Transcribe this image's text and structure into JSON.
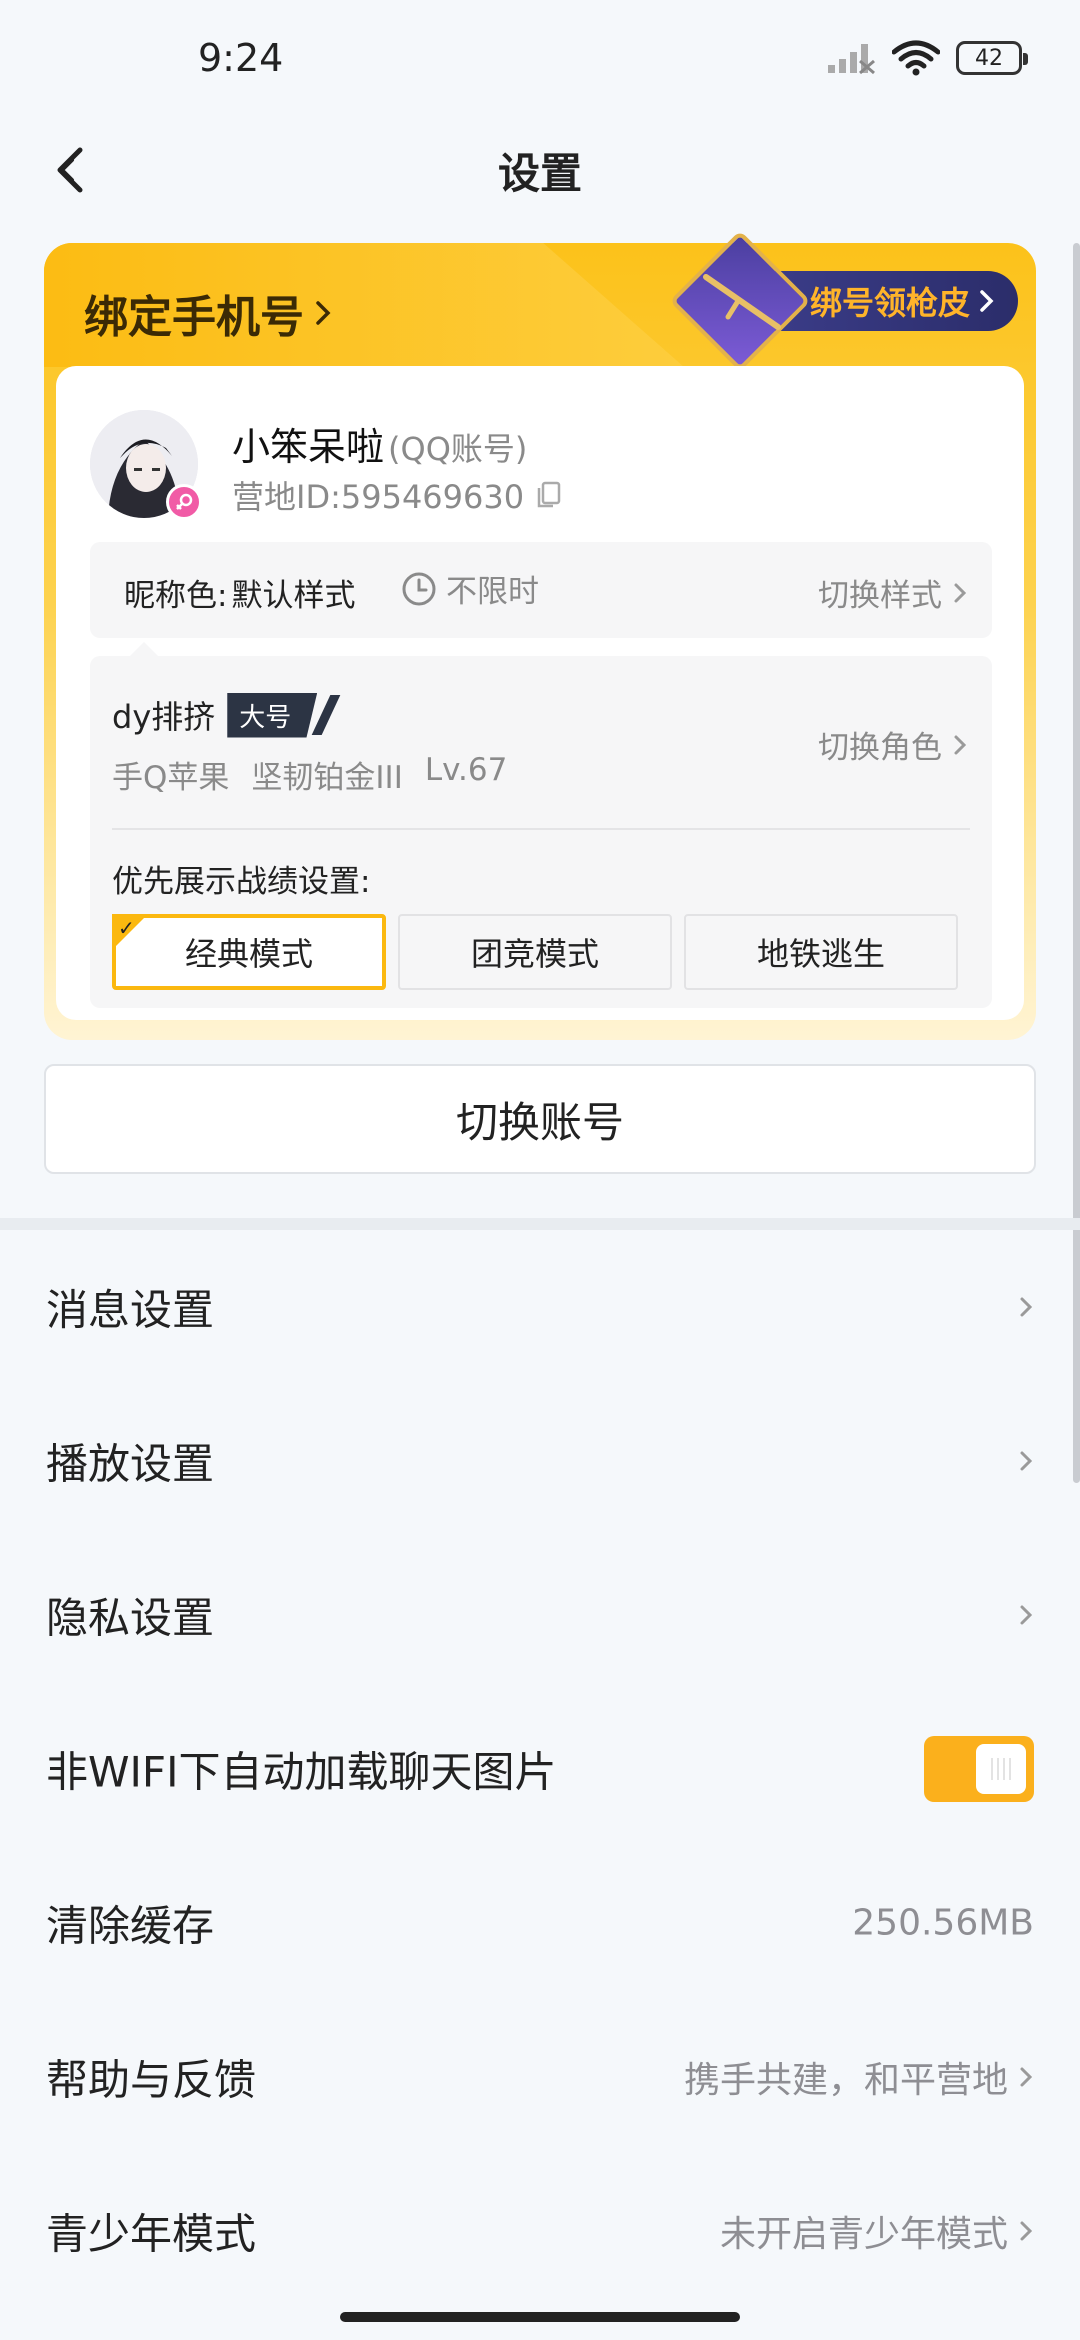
{
  "status_bar": {
    "time": "9:24",
    "battery": "42",
    "signal_icon": "signal-icon",
    "wifi_icon": "wifi-icon"
  },
  "header": {
    "title": "设置",
    "back_icon": "back-arrow-icon"
  },
  "bind_card": {
    "title": "绑定手机号",
    "promo_text": "绑号领枪皮"
  },
  "profile": {
    "nickname": "小笨呆啦",
    "account_type": "(QQ账号)",
    "camp_id": "营地ID:595469630",
    "nickname_color_label": "昵称色:",
    "nickname_color_value": "默认样式",
    "nickname_color_duration": "不限时",
    "switch_style": "切换样式"
  },
  "role": {
    "name": "dy排挤",
    "tag": "大号",
    "platform": "手Q苹果",
    "rank": "坚韧铂金III",
    "level": "Lv.67",
    "switch_role": "切换角色",
    "priority_label": "优先展示战绩设置:",
    "modes": [
      "经典模式",
      "团竞模式",
      "地铁逃生"
    ],
    "active_mode": "经典模式"
  },
  "switch_account": "切换账号",
  "settings": {
    "message": "消息设置",
    "playback": "播放设置",
    "privacy": "隐私设置",
    "wifi_autoload": "非WIFI下自动加载聊天图片",
    "wifi_autoload_on": true,
    "clear_cache": "清除缓存",
    "cache_size": "250.56MB",
    "help": "帮助与反馈",
    "help_sub": "携手共建，和平营地",
    "teen": "青少年模式",
    "teen_sub": "未开启青少年模式"
  },
  "colors": {
    "accent": "#fbb80f",
    "toggle_on": "#fbb01c",
    "promo_text": "#ffb42a",
    "badge_pink": "#f15ba6"
  }
}
